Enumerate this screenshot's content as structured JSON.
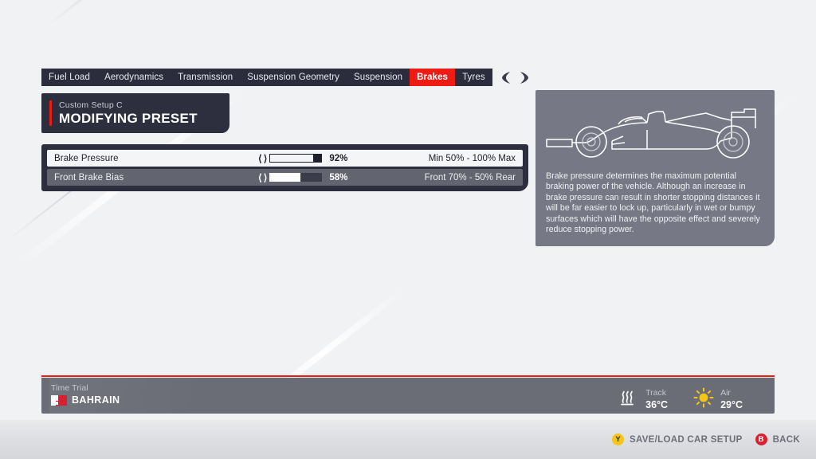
{
  "tabs": [
    {
      "label": "Fuel Load",
      "active": false
    },
    {
      "label": "Aerodynamics",
      "active": false
    },
    {
      "label": "Transmission",
      "active": false
    },
    {
      "label": "Suspension Geometry",
      "active": false
    },
    {
      "label": "Suspension",
      "active": false
    },
    {
      "label": "Brakes",
      "active": true
    },
    {
      "label": "Tyres",
      "active": false
    }
  ],
  "bumpers": {
    "left": "left-bumper-icon",
    "right": "right-bumper-icon"
  },
  "preset": {
    "subtitle": "Custom Setup  C",
    "title": "MODIFYING PRESET",
    "accent_color": "#ee1b14"
  },
  "settings": {
    "rows": [
      {
        "label": "Brake Pressure",
        "value": "92%",
        "fill_percent": 84,
        "range": "Min 50% - 100% Max",
        "selected": true
      },
      {
        "label": "Front Brake Bias",
        "value": "58%",
        "fill_percent": 58,
        "range": "Front 70% - 50% Rear",
        "selected": false
      }
    ]
  },
  "info": {
    "car_image": "f1-car-side-profile-outline",
    "description": "Brake pressure determines the maximum potential braking power of the vehicle. Although an increase in brake pressure can result in shorter stopping distances it will be far easier to lock up, particularly in wet or bumpy surfaces which will have the opposite effect and severely reduce stopping power."
  },
  "session": {
    "mode": "Time Trial",
    "track": "BAHRAIN",
    "flag": "bahrain-flag-icon"
  },
  "weather": [
    {
      "icon": "heat-waves-icon",
      "label": "Track",
      "value": "36°C"
    },
    {
      "icon": "sun-icon",
      "label": "Air",
      "value": "29°C"
    }
  ],
  "prompts": [
    {
      "button": "Y",
      "label": "SAVE/LOAD CAR SETUP",
      "color": "#f5c518"
    },
    {
      "button": "B",
      "label": "BACK",
      "color": "#d8212f"
    }
  ]
}
